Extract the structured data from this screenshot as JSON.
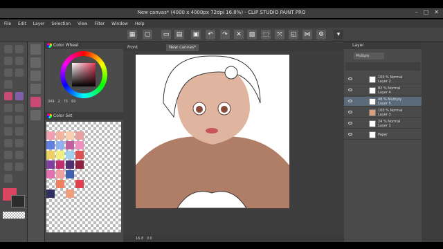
{
  "window": {
    "title": "New canvas* (4000 x 4000px 72dpi 16.8%) - CLIP STUDIO PAINT PRO"
  },
  "menu": [
    "File",
    "Edit",
    "Layer",
    "Selection",
    "View",
    "Filter",
    "Window",
    "Help"
  ],
  "panels": {
    "color_wheel": "Color Wheel",
    "color_set": "Color Set",
    "color_values": [
      "349",
      "2",
      "75",
      "60"
    ]
  },
  "tabs": [
    "Front",
    "New canvas*"
  ],
  "layers": {
    "tab": "Layer",
    "blend_mode": "Multiply",
    "items": [
      {
        "line1": "100 % Normal",
        "line2": "Layer 2"
      },
      {
        "line1": "82 % Normal",
        "line2": "Layer 4"
      },
      {
        "line1": "48 % Multiply",
        "line2": "Layer 5"
      },
      {
        "line1": "100 % Normal",
        "line2": "Layer 3"
      },
      {
        "line1": "24 % Normal",
        "line2": "Layer 1"
      },
      {
        "line1": "Paper",
        "line2": ""
      }
    ]
  },
  "status": {
    "zoom": "16.8",
    "angle": "0.0"
  },
  "colors": {
    "main": "#d9455f",
    "swatch_fg": "#d9455f",
    "swatch_bg": "#2b2b2b"
  }
}
